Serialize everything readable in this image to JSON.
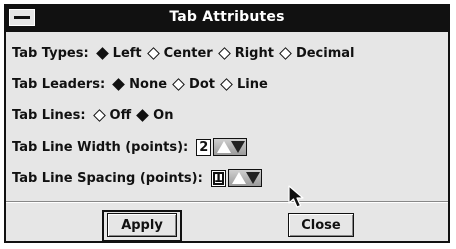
{
  "window": {
    "title": "Tab Attributes"
  },
  "icons": {
    "system_menu": "system-menu-icon",
    "cursor": "mouse-pointer-icon",
    "spinner": "spin-arrows-icon"
  },
  "tab_types": {
    "label": "Tab Types:",
    "options": [
      {
        "label": "Left",
        "selected": true
      },
      {
        "label": "Center",
        "selected": false
      },
      {
        "label": "Right",
        "selected": false
      },
      {
        "label": "Decimal",
        "selected": false
      }
    ]
  },
  "tab_leaders": {
    "label": "Tab Leaders:",
    "options": [
      {
        "label": "None",
        "selected": true
      },
      {
        "label": "Dot",
        "selected": false
      },
      {
        "label": "Line",
        "selected": false
      }
    ]
  },
  "tab_lines": {
    "label": "Tab Lines:",
    "options": [
      {
        "label": "Off",
        "selected": false
      },
      {
        "label": "On",
        "selected": true
      }
    ]
  },
  "tab_line_width": {
    "label": "Tab Line Width (points):",
    "value": "2"
  },
  "tab_line_spacing": {
    "label": "Tab Line Spacing (points):",
    "value": "1"
  },
  "buttons": {
    "apply": "Apply",
    "close": "Close"
  }
}
